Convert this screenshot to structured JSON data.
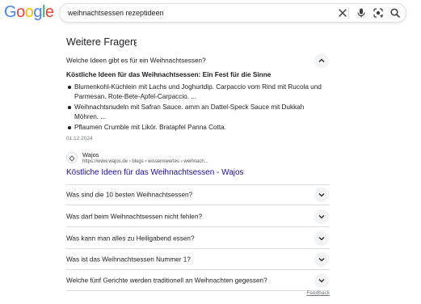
{
  "header": {
    "logo_letters": [
      {
        "ch": "G",
        "color": "#4285F4"
      },
      {
        "ch": "o",
        "color": "#EA4335"
      },
      {
        "ch": "o",
        "color": "#FBBC05"
      },
      {
        "ch": "g",
        "color": "#4285F4"
      },
      {
        "ch": "l",
        "color": "#34A853"
      },
      {
        "ch": "e",
        "color": "#EA4335"
      }
    ],
    "search_value": "weihnachtsessen rezeptideen",
    "icons": [
      "close-icon",
      "microphone-icon",
      "camera-lens-icon",
      "search-icon"
    ]
  },
  "section": {
    "title": "Weitere Fragen"
  },
  "expanded_question": {
    "question": "Welche Ideen gibt es für ein Weihnachtsessen?",
    "answer_heading": "Köstliche Ideen für das Weihnachtsessen: Ein Fest für die Sinne",
    "answer_items": [
      "Blumenkohl-Küchlein mit Lachs und Joghurtdip. Carpaccio vom Rind mit Rucola und Parmesan. Rote-Bete-Apfel-Carpaccio. ...",
      "Weihnachtsnudeln mit Safran Sauce. amm an Dattel-Speck Sauce mit Dukkah Möhren. ...",
      "Pflaumen Crumble mit Likör. Bratapfel Panna Cotta."
    ],
    "date": "01.12.2024",
    "source_name": "Wajos",
    "source_url": "https://www.wajos.de › blogs › wissenswertes › weihnach...",
    "result_title": "Köstliche Ideen für das Weihnachtsessen - Wajos"
  },
  "questions": [
    "Was sind die 10 besten Weihnachtsessen?",
    "Was darf beim Weihnachtsessen nicht fehlen?",
    "Was kann man alles zu Heiligabend essen?",
    "Was ist das Weihnachtsessen Nummer 1?",
    "Welche fünf Gerichte werden traditionell an Weihnachten gegessen?"
  ],
  "feedback_label": "Feedback",
  "colors": {
    "link": "#1a0dab",
    "divider": "#dadce0",
    "chevron_bg": "#f1f3f4",
    "muted_text": "#70757a"
  }
}
